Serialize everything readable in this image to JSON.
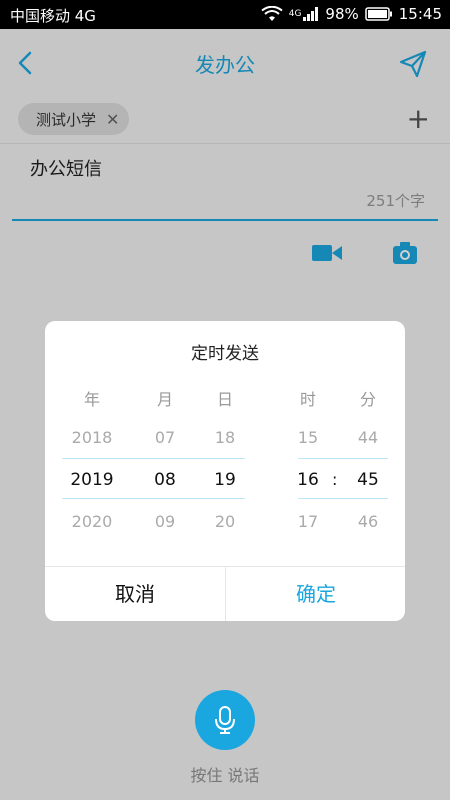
{
  "status_bar": {
    "carrier": "中国移动 4G",
    "network": "4G",
    "battery": "98%",
    "time": "15:45"
  },
  "header": {
    "title": "发办公"
  },
  "recipients": [
    {
      "name": "测试小学"
    }
  ],
  "message": {
    "title": "办公短信",
    "char_count": "251个字"
  },
  "dialog": {
    "title": "定时发送",
    "headers": [
      "年",
      "月",
      "日",
      "时",
      "分"
    ],
    "rows": [
      [
        "2018",
        "07",
        "18",
        "15",
        "44"
      ],
      [
        "2019",
        "08",
        "19",
        "16",
        "45"
      ],
      [
        "2020",
        "09",
        "20",
        "17",
        "46"
      ]
    ],
    "separator": ":",
    "cancel": "取消",
    "confirm": "确定"
  },
  "voice": {
    "label": "按住 说话"
  },
  "colors": {
    "accent": "#1aa6df"
  }
}
